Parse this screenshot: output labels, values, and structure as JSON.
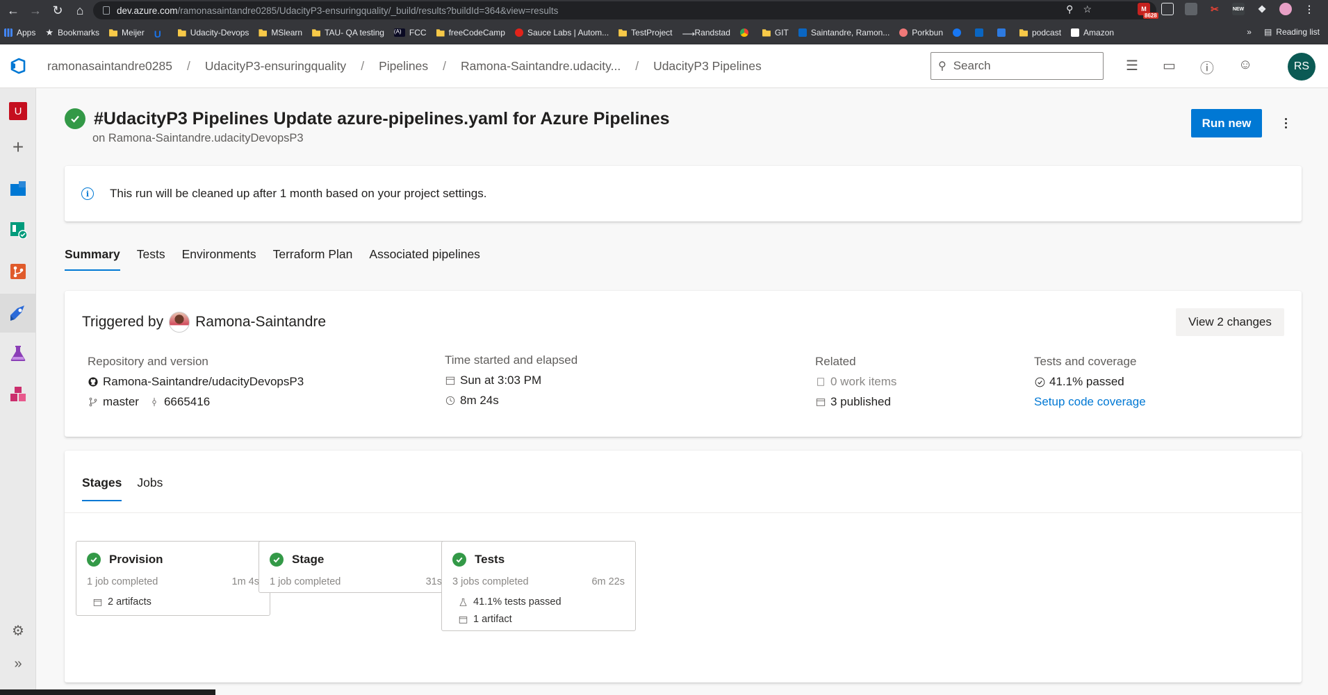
{
  "browser": {
    "url_host": "dev.azure.com",
    "url_path": "/ramonasaintandre0285/UdacityP3-ensuringquality/_build/results?buildId=364&view=results",
    "ext_badge": "8628",
    "bookmarks": [
      {
        "label": "Apps",
        "icon": "apps-grid-icon"
      },
      {
        "label": "Bookmarks",
        "icon": "star-icon"
      },
      {
        "label": "Meijer",
        "icon": "folder-icon"
      },
      {
        "label": "",
        "icon": "udemy-icon"
      },
      {
        "label": "Udacity-Devops",
        "icon": "folder-icon"
      },
      {
        "label": "MSlearn",
        "icon": "folder-icon"
      },
      {
        "label": "TAU- QA testing",
        "icon": "folder-icon"
      },
      {
        "label": "FCC",
        "icon": "fcc-icon"
      },
      {
        "label": "freeCodeCamp",
        "icon": "folder-icon"
      },
      {
        "label": "Sauce Labs | Autom...",
        "icon": "saucelabs-icon"
      },
      {
        "label": "TestProject",
        "icon": "folder-icon"
      },
      {
        "label": "Randstad",
        "icon": "randstad-icon"
      },
      {
        "label": "",
        "icon": "chrome-icon"
      },
      {
        "label": "GIT",
        "icon": "folder-icon"
      },
      {
        "label": "Saintandre, Ramon...",
        "icon": "outlook-icon"
      },
      {
        "label": "Porkbun",
        "icon": "porkbun-icon"
      },
      {
        "label": "",
        "icon": "facebook-icon"
      },
      {
        "label": "",
        "icon": "linkedin-icon"
      },
      {
        "label": "",
        "icon": "site-icon"
      },
      {
        "label": "podcast",
        "icon": "folder-icon"
      },
      {
        "label": "Amazon",
        "icon": "amazon-icon"
      }
    ],
    "more_bookmarks": "»",
    "reading_list": "Reading list"
  },
  "header": {
    "breadcrumb": [
      "ramonasaintandre0285",
      "UdacityP3-ensuringquality",
      "Pipelines",
      "Ramona-Saintandre.udacity...",
      "UdacityP3 Pipelines"
    ],
    "search_placeholder": "Search",
    "avatar_initials": "RS"
  },
  "run": {
    "title": "#UdacityP3 Pipelines Update azure-pipelines.yaml for Azure Pipelines",
    "subtitle": "on Ramona-Saintandre.udacityDevopsP3",
    "run_new_label": "Run new",
    "status": "succeeded"
  },
  "info_banner": {
    "text": "This run will be cleaned up after 1 month based on your project settings."
  },
  "tabs": [
    {
      "label": "Summary",
      "active": true
    },
    {
      "label": "Tests",
      "active": false
    },
    {
      "label": "Environments",
      "active": false
    },
    {
      "label": "Terraform Plan",
      "active": false
    },
    {
      "label": "Associated pipelines",
      "active": false
    }
  ],
  "summary": {
    "triggered_label": "Triggered by",
    "triggered_user": "Ramona-Saintandre",
    "view_changes": "View 2 changes",
    "repo_label": "Repository and version",
    "repo": "Ramona-Saintandre/udacityDevopsP3",
    "branch": "master",
    "commit": "6665416",
    "time_label": "Time started and elapsed",
    "started": "Sun at 3:03 PM",
    "elapsed": "8m 24s",
    "related_label": "Related",
    "work_items": "0 work items",
    "published": "3 published",
    "tests_label": "Tests and coverage",
    "tests_passed": "41.1% passed",
    "coverage_link": "Setup code coverage"
  },
  "stages_section": {
    "tabs": [
      {
        "label": "Stages",
        "active": true
      },
      {
        "label": "Jobs",
        "active": false
      }
    ],
    "stages": [
      {
        "name": "Provision",
        "jobs": "1 job completed",
        "duration": "1m 4s",
        "lines": [
          {
            "icon": "artifact-icon",
            "text": "2 artifacts"
          }
        ]
      },
      {
        "name": "Stage",
        "jobs": "1 job completed",
        "duration": "31s",
        "lines": []
      },
      {
        "name": "Tests",
        "jobs": "3 jobs completed",
        "duration": "6m 22s",
        "lines": [
          {
            "icon": "flask-icon",
            "text": "41.1% tests passed"
          },
          {
            "icon": "artifact-icon",
            "text": "1 artifact"
          }
        ]
      }
    ]
  },
  "colors": {
    "accent": "#0078d4",
    "success": "#339947",
    "avatar_bg": "#0b5a54"
  }
}
